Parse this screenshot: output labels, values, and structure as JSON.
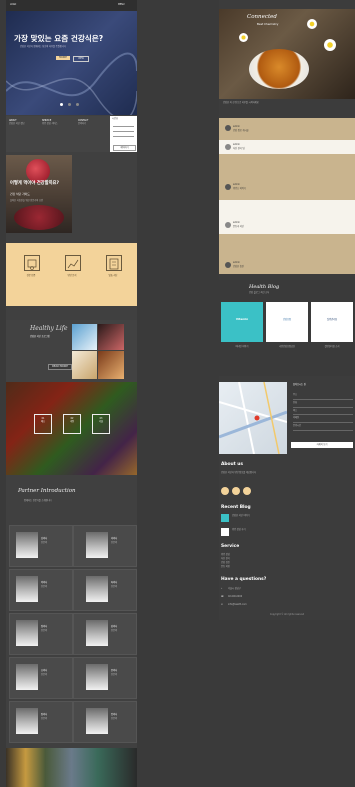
{
  "left": {
    "nav": {
      "logo": "LOGO",
      "menu": "MENU"
    },
    "hero": {
      "title": "가장 맞있는 요즘 건강식은?",
      "subtitle": "건강한 식단과 함께하는 당신의 하루를 응원합니다",
      "btn_primary": "MORE",
      "btn_secondary": "VIEW"
    },
    "info_cols": [
      {
        "title": "ABOUT",
        "text": "건강한 식단 정보"
      },
      {
        "title": "SERVICE",
        "text": "영양 상담 서비스"
      },
      {
        "title": "CONTACT",
        "text": "문의하기"
      }
    ],
    "info_table": {
      "label": "시간표",
      "button": "예약하기"
    },
    "red_section": {
      "title": "어떻게 먹어야 건강할까요?",
      "subtitle": "건강 식단 가이드",
      "text": "올바른 식습관을 위한 전문가의 조언"
    },
    "features": [
      {
        "icon": "certificate-icon",
        "label": "전문 인증"
      },
      {
        "icon": "chart-icon",
        "label": "영양 분석"
      },
      {
        "icon": "document-icon",
        "label": "맞춤 식단"
      }
    ],
    "promo": {
      "script": "Healthy Life",
      "title": "건강한 식단 프로그램",
      "button": "READ MORE"
    },
    "veg": {
      "items": [
        {
          "num": "01",
          "label": "채소"
        },
        {
          "num": "02",
          "label": "과일"
        },
        {
          "num": "03",
          "label": "곡물"
        }
      ]
    },
    "partner": {
      "script": "Partner Introduction",
      "subtitle": "함께하는 전문가를 소개합니다"
    },
    "doctors": [
      {
        "name": "김의사",
        "role": "전문의"
      },
      {
        "name": "이의사",
        "role": "전문의"
      },
      {
        "name": "박의사",
        "role": "전문의"
      },
      {
        "name": "최의사",
        "role": "전문의"
      },
      {
        "name": "정의사",
        "role": "전문의"
      },
      {
        "name": "강의사",
        "role": "전문의"
      },
      {
        "name": "조의사",
        "role": "전문의"
      },
      {
        "name": "윤의사",
        "role": "전문의"
      },
      {
        "name": "장의사",
        "role": "전문의"
      },
      {
        "name": "임의사",
        "role": "전문의"
      }
    ]
  },
  "right": {
    "tea": {
      "script": "Connected",
      "title": "Best Chemistry"
    },
    "intro_text": "건강한 차 한 잔으로 하루를 시작하세요",
    "posts": [
      {
        "author": "admin",
        "text": "건강 정보 게시물"
      },
      {
        "author": "admin",
        "text": "식단 관리 팁"
      },
      {
        "author": "admin",
        "text": "영양소 이야기"
      },
      {
        "author": "admin",
        "text": "운동과 식단"
      },
      {
        "author": "admin",
        "text": "건강한 습관"
      }
    ],
    "health_blog": {
      "title": "Health Blog",
      "subtitle": "건강 블로그 최신 소식",
      "cards": [
        {
          "logo": "Vitamin",
          "text": "비타민 이야기"
        },
        {
          "logo": "건강보험",
          "text": "국민건강보험공단"
        },
        {
          "logo": "질병관리청",
          "text": "질병관리청 소식"
        }
      ]
    },
    "location": {
      "title": "찾아오시는 길",
      "rows": [
        "주소",
        "전화",
        "팩스",
        "이메일",
        "운영시간"
      ],
      "button": "자세히 보기"
    },
    "about": {
      "title": "About us",
      "text": "건강한 식단과 영양 정보를 제공합니다"
    },
    "recent_blog": {
      "title": "Recent Blog",
      "items": [
        "건강한 식단 이야기",
        "영양 상담 후기"
      ]
    },
    "service": {
      "title": "Service",
      "items": [
        "영양 상담",
        "식단 관리",
        "건강 검진",
        "운동 처방"
      ]
    },
    "question": {
      "title": "Have a questions?",
      "items": [
        "서울시 강남구",
        "02-000-0000",
        "info@health.com"
      ]
    },
    "footer": "Copyright © All rights reserved"
  },
  "colors": {
    "accent": "#f3d39a",
    "bg": "#3a3a3a",
    "card": "#4a4a4a"
  }
}
